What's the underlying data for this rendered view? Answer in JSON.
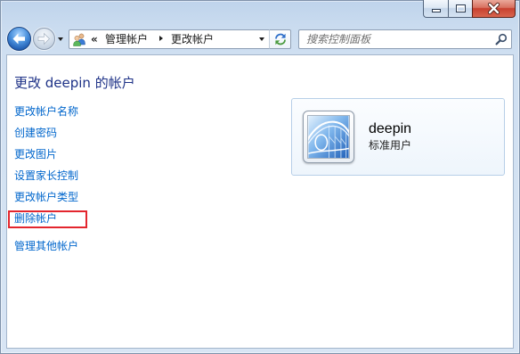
{
  "window": {
    "minimize_icon": "minimize-icon",
    "maximize_icon": "maximize-icon",
    "close_icon": "close-icon"
  },
  "navigation": {
    "back_icon": "back-arrow-icon",
    "forward_icon": "forward-arrow-icon",
    "recent_pages_icon": "chevron-down-icon"
  },
  "address_bar": {
    "location_icon": "user-accounts-icon",
    "overflow_label": "«",
    "crumbs": [
      {
        "label": "管理帐户"
      },
      {
        "label": "更改帐户"
      }
    ],
    "separator_icon": "chevron-right-icon",
    "dropdown_icon": "chevron-down-icon",
    "refresh_icon": "refresh-icon"
  },
  "search": {
    "placeholder": "搜索控制面板",
    "icon": "search-icon"
  },
  "main": {
    "title": "更改 deepin 的帐户",
    "tasks": [
      {
        "label": "更改帐户名称"
      },
      {
        "label": "创建密码"
      },
      {
        "label": "更改图片"
      },
      {
        "label": "设置家长控制"
      },
      {
        "label": "更改帐户类型"
      },
      {
        "label": "删除帐户",
        "highlighted": true
      }
    ],
    "manage_other_label": "管理其他帐户"
  },
  "account": {
    "picture_icon": "account-picture-icon",
    "name": "deepin",
    "type": "标准用户"
  },
  "colors": {
    "link": "#0066cc",
    "heading": "#1e3287",
    "annotation": "#e3262e",
    "close": "#c7402f",
    "frame": "#cfdff1"
  }
}
